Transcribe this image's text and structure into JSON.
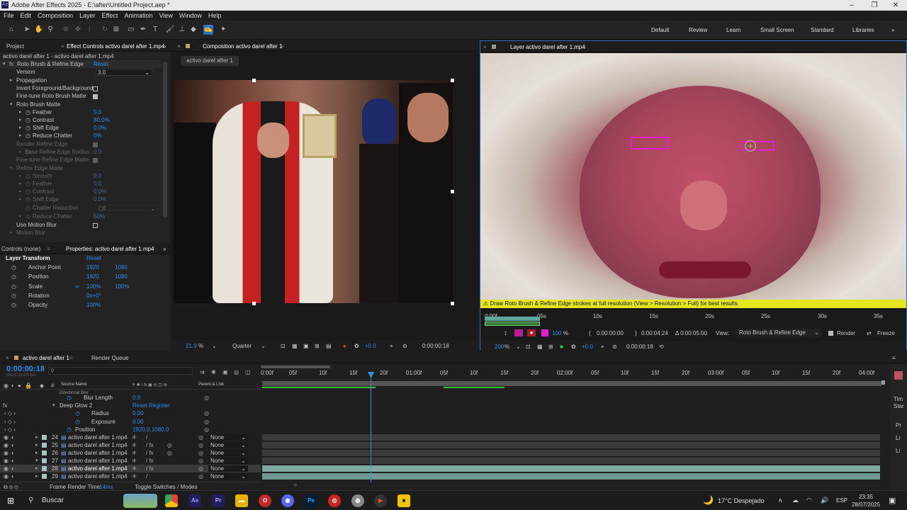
{
  "window": {
    "title": "Adobe After Effects 2025 - E:\\after\\Untitled Project.aep *",
    "app_icon": "Ae"
  },
  "menu": [
    "File",
    "Edit",
    "Composition",
    "Layer",
    "Effect",
    "Animation",
    "View",
    "Window",
    "Help"
  ],
  "workspaces": [
    "Default",
    "Review",
    "Learn",
    "Small Screen",
    "Standard",
    "Libraries"
  ],
  "project_panel": {
    "tab": "Project"
  },
  "effect_controls": {
    "tab": "Effect Controls activo darel after 1.mp4",
    "subtitle": "activo darel after 1 - activo darel after 1.mp4",
    "effect_name": "Roto Brush & Refine Edge",
    "reset": "Reset",
    "version_label": "Version",
    "version_value": "3.0",
    "propagation": "Propagation",
    "invert_fg_bg": "Invert Foreground/Background",
    "fine_tune": "Fine-tune Roto Brush Matte",
    "roto_matte": "Roto Brush Matte",
    "feather_label": "Feather",
    "feather_value": "5.0",
    "contrast_label": "Contrast",
    "contrast_value": "80.0%",
    "shift_label": "Shift Edge",
    "shift_value": "0.0%",
    "chatter_label": "Reduce Chatter",
    "chatter_value": "0%",
    "render_refine": "Render Refine Edge",
    "base_radius_label": "Base Refine Edge Radius",
    "base_radius_value": "0.0",
    "fine_tune_refine": "Fine-tune Refine Edge Matte",
    "refine_matte": "Refine Edge Matte",
    "smooth_label": "Smooth",
    "smooth_value": "0.0",
    "feather2_label": "Feather",
    "feather2_value": "0.0",
    "contrast2_label": "Contrast",
    "contrast2_value": "0.0%",
    "shift2_label": "Shift Edge",
    "shift2_value": "0.0%",
    "chatter_red_label": "Chatter Reduction",
    "chatter_red_value": "Off",
    "chatter2_label": "Reduce Chatter",
    "chatter2_value": "50%",
    "use_motion_blur": "Use Motion Blur",
    "motion_blur": "Motion Blur"
  },
  "properties_panel": {
    "controls_tab": "Controls (none)",
    "tab": "Properties: activo darel after 1.mp4",
    "section": "Layer Transform",
    "reset": "Reset",
    "anchor_label": "Anchor Point",
    "anchor_x": "1920",
    "anchor_y": "1080",
    "position_label": "Position",
    "position_x": "1920",
    "position_y": "1080",
    "scale_label": "Scale",
    "scale_x": "100%",
    "scale_y": "100%",
    "rotation_label": "Rotation",
    "rotation_value": "0x+0°",
    "opacity_label": "Opacity",
    "opacity_value": "100%"
  },
  "composition_viewer": {
    "tab": "Composition activo darel after 1",
    "subtab": "activo darel after 1",
    "zoom": "21.9",
    "zoom_unit": "%",
    "resolution": "Quarter",
    "exposure": "+0.0",
    "timecode": "0:00:00:18"
  },
  "layer_viewer": {
    "tab": "Layer activo darel after 1.mp4",
    "warning": "Draw Roto Brush & Refine Edge strokes at full resolution (View > Resolution > Full) for best results.",
    "ruler": [
      "0:00f",
      "05s",
      "10s",
      "15s",
      "20s",
      "25s",
      "30s",
      "35s"
    ],
    "opacity": "100",
    "in_time": "0:00:00:00",
    "out_time": "0:00:04:24",
    "duration": "Δ 0:00:05:00",
    "view_label": "View:",
    "view_value": "Roto Brush & Refine Edge",
    "render_label": "Render",
    "freeze_label": "Freeze",
    "zoom": "200",
    "zoom_unit": "%",
    "exposure": "+0.0",
    "timecode": "0:00:00:18"
  },
  "timeline": {
    "tab": "activo darel after 1",
    "render_queue": "Render Queue",
    "timecode": "0:00:00:18",
    "timecode_sub": "00018 (23.976 fps)",
    "search_placeholder": "",
    "col_source": "Source Name",
    "col_parent": "Parent & Link",
    "ruler": [
      "0:00f",
      "05f",
      "10f",
      "15f",
      "20f",
      "01:00f",
      "05f",
      "10f",
      "15f",
      "20f",
      "02:00f",
      "05f",
      "10f",
      "15f",
      "20f",
      "03:00f",
      "05f",
      "10f",
      "15f",
      "20f",
      "04:00f"
    ],
    "rows": [
      {
        "text": "Directional Blur"
      },
      {
        "text": "Blur Length",
        "value": "0.0"
      },
      {
        "text": "Deep Glow 2",
        "reset": "Reset",
        "register": "Register"
      },
      {
        "text": "Radius",
        "value": "0.00"
      },
      {
        "text": "Exposure",
        "value": "0.00"
      },
      {
        "text": "Position",
        "value": "1920.0,1080.0"
      }
    ],
    "layers": [
      {
        "num": "24",
        "name": "activo darel after 1.mp4",
        "parent": "None"
      },
      {
        "num": "25",
        "name": "activo darel after 1.mp4",
        "parent": "None"
      },
      {
        "num": "26",
        "name": "activo darel after 1.mp4",
        "parent": "None"
      },
      {
        "num": "27",
        "name": "activo darel after 1.mp4",
        "parent": "None"
      },
      {
        "num": "28",
        "name": "activo darel after 1.mp4",
        "parent": "None"
      },
      {
        "num": "29",
        "name": "activo darel after 1.mp4",
        "parent": "None"
      }
    ],
    "frame_render": "Frame Render Time:",
    "frame_render_value": "14ms",
    "toggle": "Toggle Switches / Modes",
    "right_labels": [
      "Tim",
      "Star",
      "Pr",
      "Li",
      "Li"
    ]
  },
  "taskbar": {
    "search": "Buscar",
    "weather": "17°C Despejado",
    "lang": "ESP",
    "time": "23:35",
    "date": "28/07/2025",
    "apps": [
      {
        "label": "Ae",
        "color": "#1f1f5e"
      },
      {
        "label": "Pr",
        "color": "#1f1f5e"
      },
      {
        "label": "",
        "color": "#e6b400"
      },
      {
        "label": "",
        "color": "#c62828"
      },
      {
        "label": "",
        "color": "#5865f2"
      },
      {
        "label": "Ps",
        "color": "#001e36"
      },
      {
        "label": "",
        "color": "#cc2222"
      },
      {
        "label": "",
        "color": "#888888"
      },
      {
        "label": "",
        "color": "#e05020"
      },
      {
        "label": "",
        "color": "#f5c400"
      }
    ]
  },
  "colors": {
    "accent": "#2d8ceb",
    "warning_bg": "#e6e61e",
    "roto_magenta": "#e020d0",
    "playhead": "#3a8ee6"
  }
}
